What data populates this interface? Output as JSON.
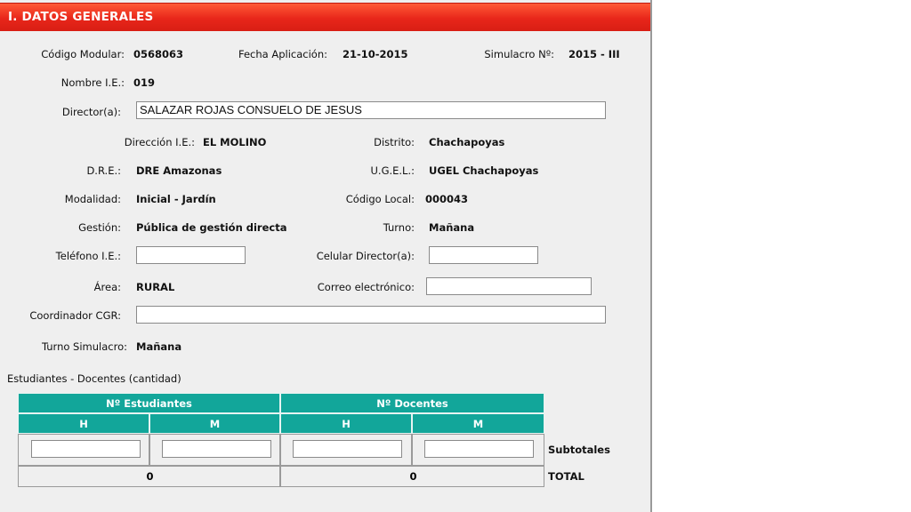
{
  "section": {
    "title": "I. DATOS GENERALES"
  },
  "general": {
    "codigo_modular_label": "Código Modular:",
    "codigo_modular_value": "0568063",
    "fecha_label": "Fecha Aplicación:",
    "fecha_value": "21-10-2015",
    "simulacro_label": "Simulacro Nº:",
    "simulacro_value": "2015 - III",
    "nombre_label": "Nombre I.E.:",
    "nombre_value": "019",
    "director_label": "Director(a):",
    "director_value": "SALAZAR ROJAS CONSUELO DE JESUS",
    "direccion_label": "Dirección I.E.:",
    "direccion_value": "EL MOLINO",
    "distrito_label": "Distrito:",
    "distrito_value": "Chachapoyas",
    "dre_label": "D.R.E.:",
    "dre_value": "DRE Amazonas",
    "ugel_label": "U.G.E.L.:",
    "ugel_value": "UGEL Chachapoyas",
    "modalidad_label": "Modalidad:",
    "modalidad_value": "Inicial - Jardín",
    "codigo_local_label": "Código Local:",
    "codigo_local_value": "000043",
    "gestion_label": "Gestión:",
    "gestion_value": "Pública de gestión directa",
    "turno_label": "Turno:",
    "turno_value": "Mañana",
    "telefono_label": "Teléfono I.E.:",
    "telefono_value": "",
    "celular_label": "Celular Director(a):",
    "celular_value": "",
    "area_label": "Área:",
    "area_value": "RURAL",
    "correo_label": "Correo electrónico:",
    "correo_value": "",
    "coordinador_label": "Coordinador CGR:",
    "coordinador_value": "",
    "turno_simulacro_label": "Turno Simulacro:",
    "turno_simulacro_value": "Mañana"
  },
  "counts": {
    "section_label": "Estudiantes - Docentes (cantidad)",
    "estudiantes_header": "Nº Estudiantes",
    "docentes_header": "Nº Docentes",
    "h_label": "H",
    "m_label": "M",
    "subtotales_label": "Subtotales",
    "total_label": "TOTAL",
    "estudiantes_total": "0",
    "docentes_total": "0"
  }
}
